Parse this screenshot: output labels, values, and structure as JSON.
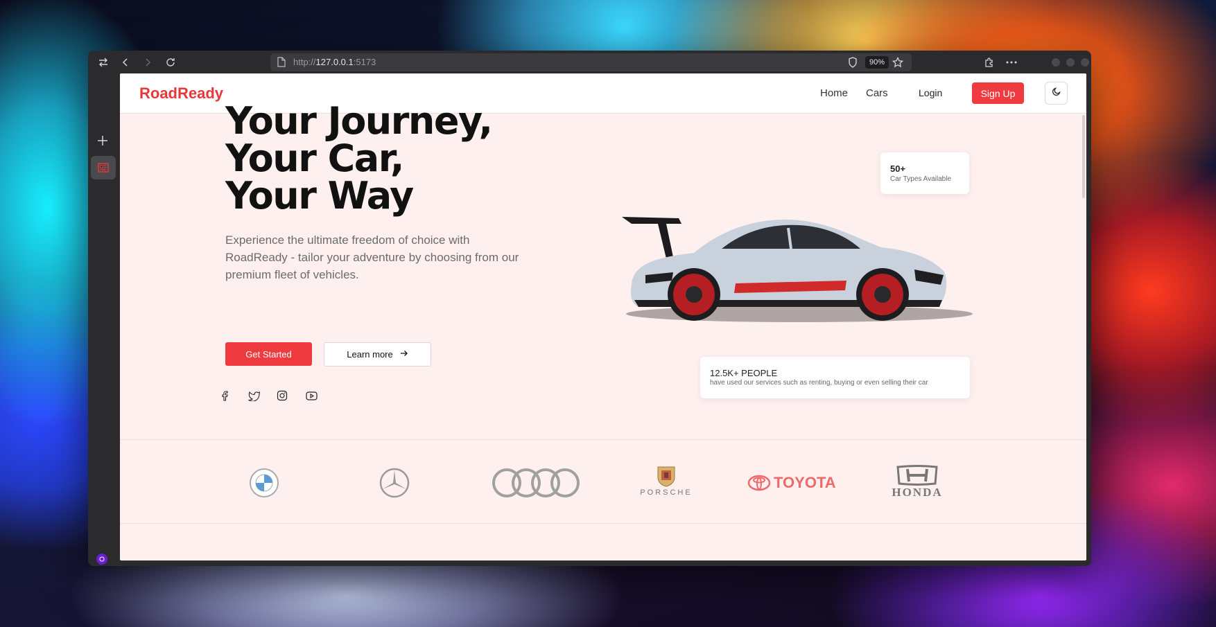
{
  "browser": {
    "url_prefix": "http://",
    "url_host": "127.0.0.1",
    "url_port": ":5173",
    "zoom": "90%",
    "icons": [
      "swap-icon",
      "back-icon",
      "forward-icon",
      "reload-icon",
      "document-icon",
      "shield-icon",
      "star-icon",
      "extension-icon",
      "more-icon"
    ]
  },
  "sidebar": {
    "icons": [
      "new-tab-icon",
      "tab-favicon",
      "ai-assistant-icon",
      "download-icon"
    ]
  },
  "nav": {
    "logo": "RoadReady",
    "links": [
      "Home",
      "Cars"
    ],
    "login": "Login",
    "signup": "Sign Up",
    "theme_icon": "moon-icon"
  },
  "hero": {
    "title_lines": [
      "Your Journey,",
      "Your Car,",
      "Your Way"
    ],
    "description": "Experience the ultimate freedom of choice with RoadReady - tailor your adventure by choosing from our premium fleet of vehicles.",
    "primary_button": "Get Started",
    "secondary_button": "Learn more",
    "social_icons": [
      "facebook-icon",
      "twitter-icon",
      "instagram-icon",
      "youtube-icon"
    ]
  },
  "stats": [
    {
      "number": "50+",
      "label": "Car Types Available"
    },
    {
      "number": "12.5K+ PEOPLE",
      "label": "have used our services such as renting, buying or even selling their car"
    }
  ],
  "brands": {
    "logos": [
      "bmw-logo",
      "mercedes-logo",
      "audi-logo",
      "porsche-logo",
      "toyota-logo",
      "honda-logo"
    ],
    "porsche_text": "PORSCHE",
    "toyota_text": "TOYOTA",
    "honda_text": "HONDA",
    "toyota_color": "#ee6a6a"
  },
  "colors": {
    "accent": "#ef3b3f",
    "page_bg": "#fff0f0"
  }
}
